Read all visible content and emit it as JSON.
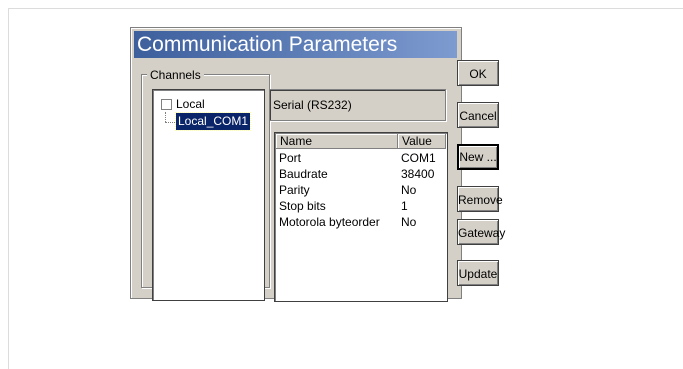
{
  "window": {
    "title": "Communication Parameters"
  },
  "channels": {
    "group_label": "Channels",
    "tree": {
      "root_label": "Local",
      "child_label": "Local_COM1"
    }
  },
  "detail": {
    "connection_type": "Serial (RS232)",
    "table": {
      "headers": [
        "Name",
        "Value"
      ],
      "rows": [
        {
          "name": "Port",
          "value": "COM1"
        },
        {
          "name": "Baudrate",
          "value": "38400"
        },
        {
          "name": "Parity",
          "value": "No"
        },
        {
          "name": "Stop bits",
          "value": "1"
        },
        {
          "name": "Motorola byteorder",
          "value": "No"
        }
      ]
    }
  },
  "buttons": {
    "ok": "OK",
    "cancel": "Cancel",
    "new": "New ...",
    "remove": "Remove",
    "gateway": "Gateway",
    "update": "Update"
  },
  "colors": {
    "dialog_bg": "#d4d0c8",
    "title_gradient_start": "#3d5f9c",
    "selection_bg": "#0a246a"
  }
}
